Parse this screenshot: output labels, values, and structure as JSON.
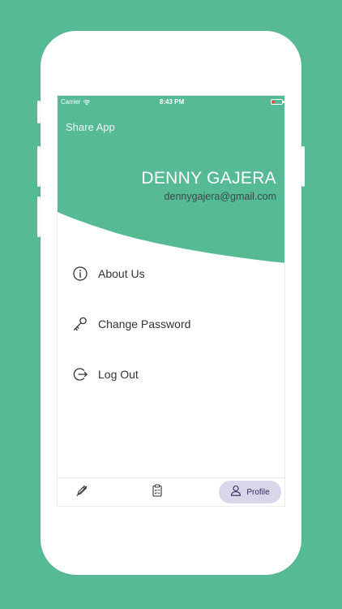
{
  "status_bar": {
    "carrier": "Carrier",
    "time": "8:43 PM",
    "battery_color": "#e74c3c"
  },
  "header": {
    "share_app": "Share App",
    "user_name": "DENNY GAJERA",
    "user_email": "dennygajera@gmail.com",
    "background_color": "#56bb95"
  },
  "menu": {
    "items": [
      {
        "label": "About Us",
        "icon": "info-circle-icon"
      },
      {
        "label": "Change Password",
        "icon": "key-icon"
      },
      {
        "label": "Log Out",
        "icon": "logout-icon"
      }
    ]
  },
  "tab_bar": {
    "tabs": [
      {
        "icon": "edit-pencil-icon",
        "label": ""
      },
      {
        "icon": "clipboard-checklist-icon",
        "label": ""
      },
      {
        "icon": "profile-user-icon",
        "label": "Profile",
        "active": true
      }
    ],
    "active_bg": "#d9d6ea",
    "active_text": "#2f2a63"
  }
}
